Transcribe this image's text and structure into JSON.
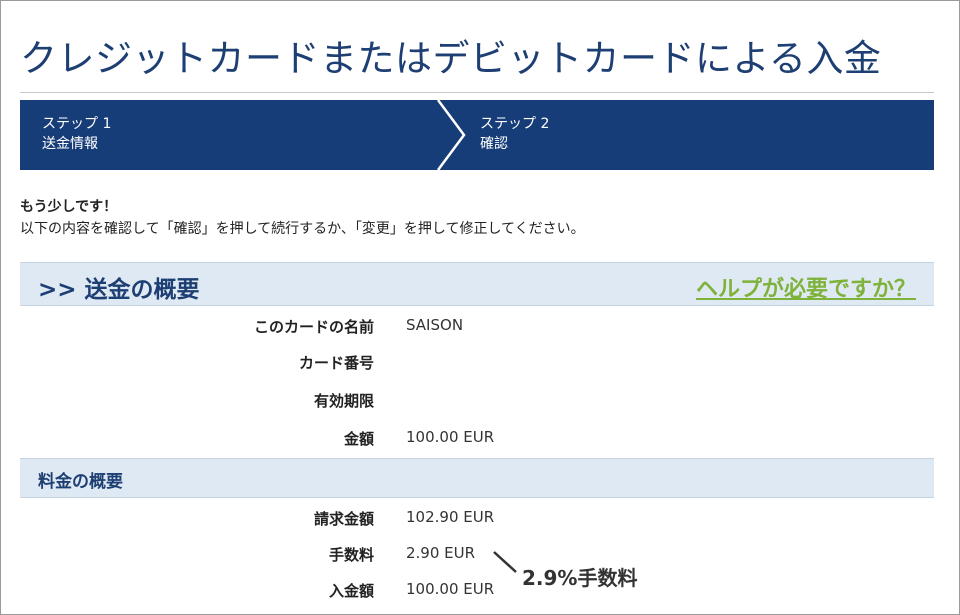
{
  "page": {
    "title": "クレジットカードまたはデビットカードによる入金"
  },
  "steps": [
    {
      "number": "ステップ 1",
      "name": "送金情報"
    },
    {
      "number": "ステップ 2",
      "name": "確認"
    }
  ],
  "intro": {
    "heading": "もう少しです！",
    "text": "以下の内容を確認して「確認」を押して続行するか、「変更」を押して修正してください。"
  },
  "transfer_summary": {
    "title": ">> 送金の概要",
    "help_link": "ヘルプが必要ですか？",
    "rows": [
      {
        "label": "このカードの名前",
        "value": "SAISON"
      },
      {
        "label": "カード番号",
        "value": ""
      },
      {
        "label": "有効期限",
        "value": ""
      },
      {
        "label": "金額",
        "value": "100.00 EUR"
      }
    ]
  },
  "fee_summary": {
    "title": "料金の概要",
    "rows": [
      {
        "label": "請求金額",
        "value": "102.90 EUR"
      },
      {
        "label": "手数料",
        "value": "2.90 EUR"
      },
      {
        "label": "入金額",
        "value": "100.00 EUR"
      }
    ]
  },
  "annotation": {
    "text": "2.9%手数料"
  },
  "colors": {
    "brand_blue": "#173d78",
    "title_blue": "#1e3f73",
    "section_bg": "#dfe9f4",
    "help_green": "#7fb23a"
  }
}
